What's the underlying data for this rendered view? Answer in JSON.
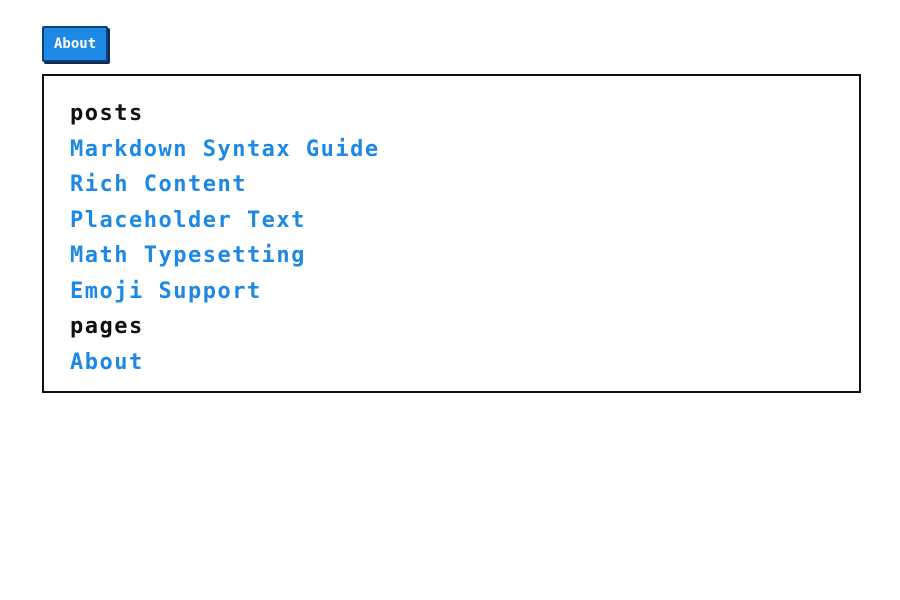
{
  "header": {
    "about_button_label": "About"
  },
  "sitemap": {
    "sections": [
      {
        "heading": "posts",
        "links": [
          "Markdown Syntax Guide",
          "Rich Content",
          "Placeholder Text",
          "Math Typesetting",
          "Emoji Support"
        ]
      },
      {
        "heading": "pages",
        "links": [
          "About"
        ]
      }
    ]
  },
  "colors": {
    "accent": "#1e88e5",
    "text": "#111111",
    "border": "#111111",
    "background": "#ffffff"
  }
}
